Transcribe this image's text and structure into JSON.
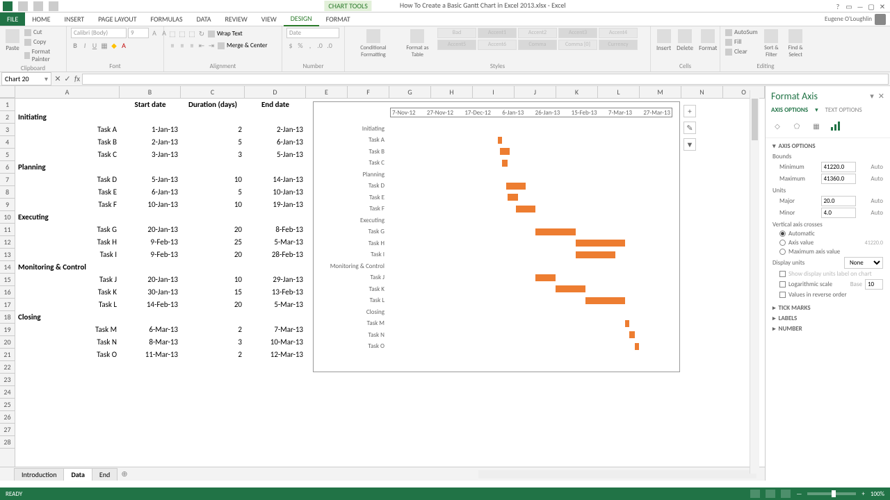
{
  "window": {
    "chart_tools": "CHART TOOLS",
    "doc_title": "How To Create a Basic Gantt Chart in Excel 2013.xlsx - Excel",
    "user": "Eugene O'Loughlin"
  },
  "tabs": [
    "FILE",
    "HOME",
    "INSERT",
    "PAGE LAYOUT",
    "FORMULAS",
    "DATA",
    "REVIEW",
    "VIEW",
    "DESIGN",
    "FORMAT"
  ],
  "ribbon": {
    "clipboard": {
      "paste": "Paste",
      "cut": "Cut",
      "copy": "Copy",
      "fp": "Format Painter",
      "label": "Clipboard"
    },
    "font": {
      "name": "Calibri (Body)",
      "size": "9",
      "label": "Font"
    },
    "alignment": {
      "wrap": "Wrap Text",
      "merge": "Merge & Center",
      "label": "Alignment"
    },
    "number": {
      "fmt": "Date",
      "label": "Number"
    },
    "styles": {
      "cf": "Conditional Formatting",
      "fat": "Format as Table",
      "label": "Styles",
      "chips": [
        "Bad",
        "Accent1",
        "Accent2",
        "Accent3",
        "Accent4",
        "Accent5",
        "Accent6",
        "Comma",
        "Comma [0]",
        "Currency"
      ]
    },
    "cells": {
      "insert": "Insert",
      "delete": "Delete",
      "format": "Format",
      "label": "Cells"
    },
    "editing": {
      "autosum": "AutoSum",
      "fill": "Fill",
      "clear": "Clear",
      "sort": "Sort & Filter",
      "find": "Find & Select",
      "label": "Editing"
    }
  },
  "namebox": "Chart 20",
  "columns": {
    "widths": {
      "A": 150,
      "B": 88,
      "C": 92,
      "D": 88,
      "E": 60,
      "F": 60,
      "G": 60,
      "H": 60,
      "I": 60,
      "J": 60,
      "K": 60,
      "L": 60,
      "M": 60,
      "N": 60,
      "O": 60
    },
    "labels": [
      "A",
      "B",
      "C",
      "D",
      "E",
      "F",
      "G",
      "H",
      "I",
      "J",
      "K",
      "L",
      "M",
      "N",
      "O"
    ]
  },
  "row_count": 28,
  "headers": {
    "B": "Start date",
    "C": "Duration (days)",
    "D": "End date"
  },
  "rows": [
    {
      "r": 2,
      "A": "Initiating",
      "bold": true
    },
    {
      "r": 3,
      "A": "Task A",
      "alignA": "right",
      "B": "1-Jan-13",
      "C": "2",
      "D": "2-Jan-13"
    },
    {
      "r": 4,
      "A": "Task B",
      "alignA": "right",
      "B": "2-Jan-13",
      "C": "5",
      "D": "6-Jan-13"
    },
    {
      "r": 5,
      "A": "Task C",
      "alignA": "right",
      "B": "3-Jan-13",
      "C": "3",
      "D": "5-Jan-13"
    },
    {
      "r": 6,
      "A": "Planning",
      "bold": true
    },
    {
      "r": 7,
      "A": "Task D",
      "alignA": "right",
      "B": "5-Jan-13",
      "C": "10",
      "D": "14-Jan-13"
    },
    {
      "r": 8,
      "A": "Task E",
      "alignA": "right",
      "B": "6-Jan-13",
      "C": "5",
      "D": "10-Jan-13"
    },
    {
      "r": 9,
      "A": "Task F",
      "alignA": "right",
      "B": "10-Jan-13",
      "C": "10",
      "D": "19-Jan-13"
    },
    {
      "r": 10,
      "A": "Executing",
      "bold": true
    },
    {
      "r": 11,
      "A": "Task G",
      "alignA": "right",
      "B": "20-Jan-13",
      "C": "20",
      "D": "8-Feb-13"
    },
    {
      "r": 12,
      "A": "Task H",
      "alignA": "right",
      "B": "9-Feb-13",
      "C": "25",
      "D": "5-Mar-13"
    },
    {
      "r": 13,
      "A": "Task I",
      "alignA": "right",
      "B": "9-Feb-13",
      "C": "20",
      "D": "28-Feb-13"
    },
    {
      "r": 14,
      "A": "Monitoring & Control",
      "bold": true
    },
    {
      "r": 15,
      "A": "Task J",
      "alignA": "right",
      "B": "20-Jan-13",
      "C": "10",
      "D": "29-Jan-13"
    },
    {
      "r": 16,
      "A": "Task K",
      "alignA": "right",
      "B": "30-Jan-13",
      "C": "15",
      "D": "13-Feb-13"
    },
    {
      "r": 17,
      "A": "Task L",
      "alignA": "right",
      "B": "14-Feb-13",
      "C": "20",
      "D": "5-Mar-13"
    },
    {
      "r": 18,
      "A": "Closing",
      "bold": true
    },
    {
      "r": 19,
      "A": "Task M",
      "alignA": "right",
      "B": "6-Mar-13",
      "C": "2",
      "D": "7-Mar-13"
    },
    {
      "r": 20,
      "A": "Task N",
      "alignA": "right",
      "B": "8-Mar-13",
      "C": "3",
      "D": "10-Mar-13"
    },
    {
      "r": 21,
      "A": "Task O",
      "alignA": "right",
      "B": "11-Mar-13",
      "C": "2",
      "D": "12-Mar-13"
    }
  ],
  "chart_data": {
    "type": "bar",
    "title": "",
    "axis_dates": [
      "7-Nov-12",
      "27-Nov-12",
      "17-Dec-12",
      "6-Jan-13",
      "26-Jan-13",
      "15-Feb-13",
      "7-Mar-13",
      "27-Mar-13"
    ],
    "axis_min_serial": 41220.0,
    "axis_max_serial": 41360.0,
    "categories": [
      "Initiating",
      "Task A",
      "Task B",
      "Task C",
      "Planning",
      "Task D",
      "Task E",
      "Task F",
      "Executing",
      "Task G",
      "Task H",
      "Task I",
      "Monitoring & Control",
      "Task J",
      "Task K",
      "Task L",
      "Closing",
      "Task M",
      "Task N",
      "Task O"
    ],
    "series": [
      {
        "name": "Start date",
        "role": "offset",
        "values_serial": [
          null,
          41275,
          41276,
          41277,
          null,
          41279,
          41280,
          41284,
          null,
          41294,
          41314,
          41314,
          null,
          41294,
          41304,
          41319,
          null,
          41339,
          41341,
          41344
        ]
      },
      {
        "name": "Duration (days)",
        "role": "length",
        "values": [
          0,
          2,
          5,
          3,
          0,
          10,
          5,
          10,
          0,
          20,
          25,
          20,
          0,
          10,
          15,
          20,
          0,
          2,
          3,
          2
        ]
      }
    ]
  },
  "pane": {
    "title": "Format Axis",
    "tab_axis": "AXIS OPTIONS",
    "tab_text": "TEXT OPTIONS",
    "section_axis": "AXIS OPTIONS",
    "bounds": "Bounds",
    "min_label": "Minimum",
    "min_val": "41220.0",
    "auto": "Auto",
    "max_label": "Maximum",
    "max_val": "41360.0",
    "units": "Units",
    "major_label": "Major",
    "major_val": "20.0",
    "minor_label": "Minor",
    "minor_val": "4.0",
    "crosses": "Vertical axis crosses",
    "r_auto": "Automatic",
    "r_axisval": "Axis value",
    "axisval_val": "41220.0",
    "r_max": "Maximum axis value",
    "display_units": "Display units",
    "display_units_val": "None",
    "show_units": "Show display units label on chart",
    "log": "Logarithmic scale",
    "log_base": "Base",
    "log_base_val": "10",
    "reverse": "Values in reverse order",
    "tick": "TICK MARKS",
    "labels": "LABELS",
    "number": "NUMBER"
  },
  "sheets": [
    "Introduction",
    "Data",
    "End"
  ],
  "active_sheet": 1,
  "status": {
    "ready": "READY",
    "zoom": "100%"
  }
}
